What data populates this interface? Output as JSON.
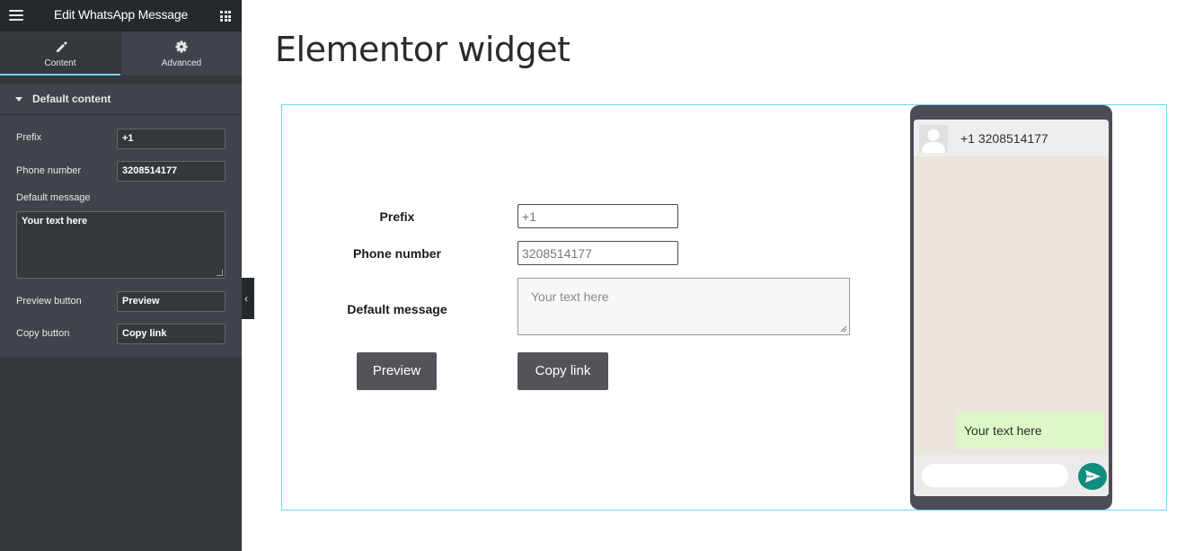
{
  "editor": {
    "title": "Edit WhatsApp Message",
    "tabs": [
      {
        "label": "Content",
        "icon": "pencil-icon",
        "active": true
      },
      {
        "label": "Advanced",
        "icon": "gear-icon",
        "active": false
      }
    ],
    "section": {
      "title": "Default content"
    },
    "fields": {
      "prefix": {
        "label": "Prefix",
        "value": "+1"
      },
      "phone": {
        "label": "Phone number",
        "value": "3208514177"
      },
      "message": {
        "label": "Default message",
        "value": "Your text here"
      },
      "preview_button": {
        "label": "Preview button",
        "value": "Preview"
      },
      "copy_button": {
        "label": "Copy button",
        "value": "Copy link"
      }
    }
  },
  "page": {
    "title": "Elementor widget"
  },
  "widget": {
    "prefix_label": "Prefix",
    "prefix_placeholder": "+1",
    "phone_label": "Phone number",
    "phone_placeholder": "3208514177",
    "message_label": "Default message",
    "message_placeholder": "Your text here",
    "preview_button": "Preview",
    "copy_button": "Copy link"
  },
  "phone_preview": {
    "contact": "+1 3208514177",
    "message": "Your text here"
  },
  "colors": {
    "editor_accent": "#71d7f7",
    "button_bg": "#53545a",
    "whatsapp_green": "#128c7e",
    "bubble_green": "#dcf8c6",
    "chat_background": "#ece5dd"
  }
}
